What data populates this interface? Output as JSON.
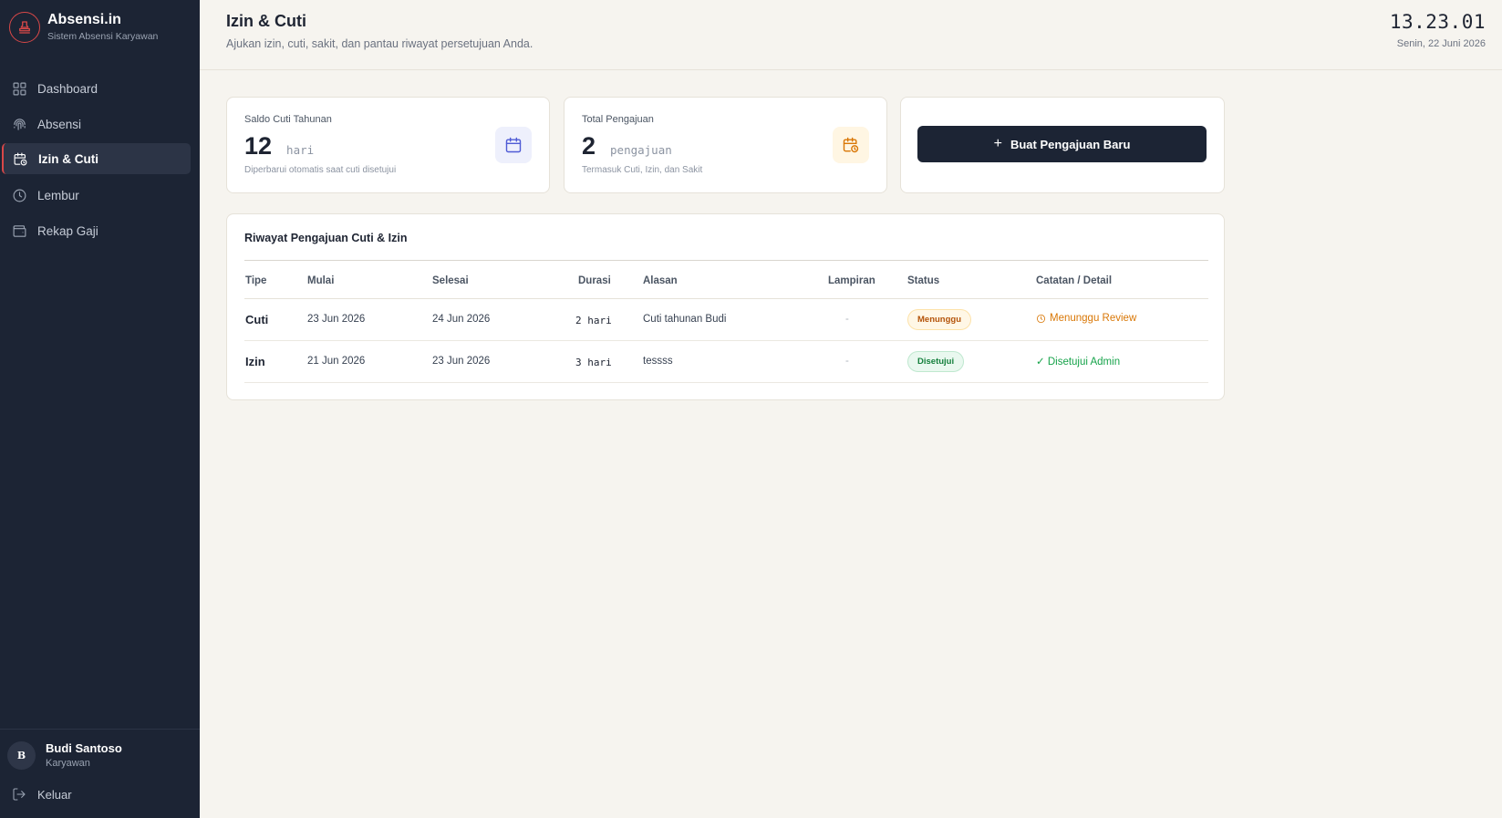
{
  "sidebar": {
    "brand_name": "Absensi.in",
    "brand_sub": "Sistem Absensi Karyawan",
    "items": [
      {
        "label": "Dashboard",
        "icon": "grid-icon"
      },
      {
        "label": "Absensi",
        "icon": "fingerprint-icon"
      },
      {
        "label": "Izin & Cuti",
        "icon": "calendar-clock-icon",
        "active": true
      },
      {
        "label": "Lembur",
        "icon": "clock-icon"
      },
      {
        "label": "Rekap Gaji",
        "icon": "wallet-icon"
      }
    ],
    "user_initial": "B",
    "user_name": "Budi Santoso",
    "user_role": "Karyawan",
    "logout_label": "Keluar"
  },
  "header": {
    "title": "Izin & Cuti",
    "subtitle": "Ajukan izin, cuti, sakit, dan pantau riwayat persetujuan Anda.",
    "clock": "13.23.01",
    "date": "Senin, 22 Juni 2026"
  },
  "cards": {
    "saldo": {
      "label": "Saldo Cuti Tahunan",
      "value": "12",
      "unit": "hari",
      "note": "Diperbarui otomatis saat cuti disetujui"
    },
    "total": {
      "label": "Total Pengajuan",
      "value": "2",
      "unit": "pengajuan",
      "note": "Termasuk Cuti, Izin, dan Sakit"
    },
    "new_button_label": "Buat Pengajuan Baru"
  },
  "table": {
    "title": "Riwayat Pengajuan Cuti & Izin",
    "columns": [
      "Tipe",
      "Mulai",
      "Selesai",
      "Durasi",
      "Alasan",
      "Lampiran",
      "Status",
      "Catatan / Detail"
    ],
    "rows": [
      {
        "tipe": "Cuti",
        "mulai": "23 Jun 2026",
        "selesai": "24 Jun 2026",
        "durasi": "2 hari",
        "alasan": "Cuti tahunan Budi",
        "lampiran": "-",
        "status": "Menunggu",
        "catatan": "Menunggu Review"
      },
      {
        "tipe": "Izin",
        "mulai": "21 Jun 2026",
        "selesai": "23 Jun 2026",
        "durasi": "3 hari",
        "alasan": "tessss",
        "lampiran": "-",
        "status": "Disetujui",
        "catatan": "✓ Disetujui Admin"
      }
    ]
  },
  "colors": {
    "sidebar_bg": "#1c2434",
    "accent_red": "#d94848",
    "page_bg": "#f6f4ef",
    "warning": "#d97706",
    "success": "#16a34a"
  }
}
